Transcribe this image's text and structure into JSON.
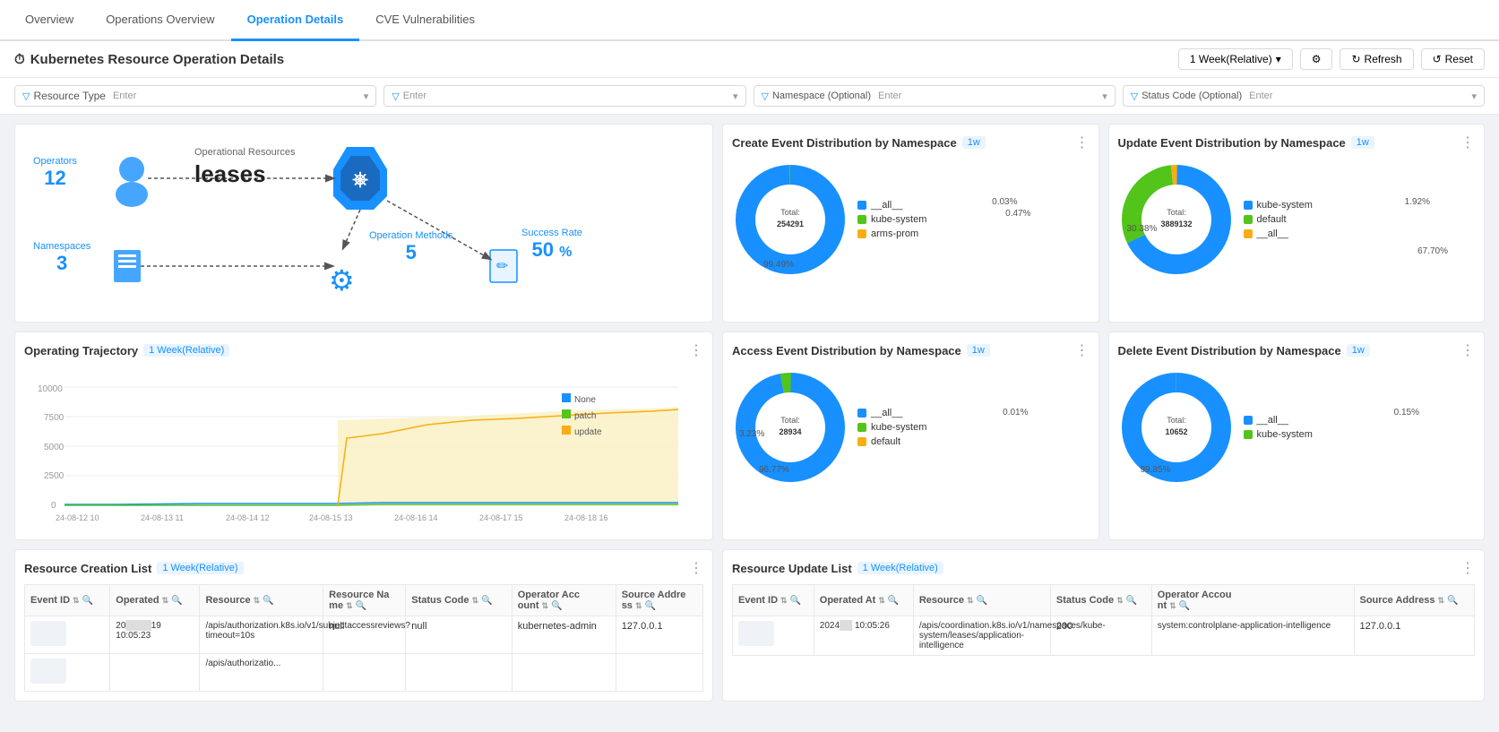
{
  "tabs": [
    {
      "label": "Overview",
      "active": false
    },
    {
      "label": "Operations Overview",
      "active": false
    },
    {
      "label": "Operation Details",
      "active": true
    },
    {
      "label": "CVE Vulnerabilities",
      "active": false
    }
  ],
  "header": {
    "title": "Kubernetes Resource Operation Details",
    "title_icon": "⏱",
    "time_range": "1 Week(Relative)",
    "refresh_label": "Refresh",
    "reset_label": "Reset"
  },
  "filters": [
    {
      "label": "Resource Type",
      "placeholder": "Enter"
    },
    {
      "placeholder": "Enter"
    },
    {
      "label": "Namespace (Optional)",
      "placeholder": "Enter"
    },
    {
      "label": "Status Code (Optional)",
      "placeholder": "Enter"
    }
  ],
  "diagram": {
    "operators_label": "Operators",
    "operators_count": "12",
    "namespaces_label": "Namespaces",
    "namespaces_count": "3",
    "resource_type_label": "Operational Resources",
    "resource_name": "leases",
    "op_methods_label": "Operation Methods",
    "op_methods_count": "5",
    "success_rate_label": "Success Rate",
    "success_rate_value": "50",
    "success_rate_unit": "%"
  },
  "charts": {
    "create": {
      "title": "Create Event Distribution by Namespace",
      "badge": "1w",
      "total": "Total:254291",
      "slices": [
        {
          "label": "__all__",
          "value": 99.49,
          "color": "#1890ff"
        },
        {
          "label": "kube-system",
          "value": 0.47,
          "color": "#52c41a"
        },
        {
          "label": "arms-prom",
          "value": 0.03,
          "color": "#faad14"
        }
      ],
      "annotations": [
        "99.49%",
        "0.47%",
        "0.03%"
      ]
    },
    "update": {
      "title": "Update Event Distribution by Namespace",
      "badge": "1w",
      "total": "Total:3889132",
      "slices": [
        {
          "label": "kube-system",
          "value": 67.7,
          "color": "#1890ff"
        },
        {
          "label": "default",
          "value": 30.38,
          "color": "#52c41a"
        },
        {
          "label": "__all__",
          "value": 1.92,
          "color": "#faad14"
        }
      ],
      "annotations": [
        "67.70%",
        "30.38%",
        "1.92%"
      ]
    },
    "access": {
      "title": "Access Event Distribution by Namespace",
      "badge": "1w",
      "total": "Total:28934",
      "slices": [
        {
          "label": "__all__",
          "value": 96.77,
          "color": "#1890ff"
        },
        {
          "label": "kube-system",
          "value": 3.23,
          "color": "#52c41a"
        },
        {
          "label": "default",
          "value": 0.01,
          "color": "#faad14"
        }
      ],
      "annotations": [
        "96.77%",
        "3.23%",
        "0.01%"
      ]
    },
    "delete": {
      "title": "Delete Event Distribution by Namespace",
      "badge": "1w",
      "total": "Total:10652",
      "slices": [
        {
          "label": "__all__",
          "value": 99.85,
          "color": "#1890ff"
        },
        {
          "label": "kube-system",
          "value": 0.15,
          "color": "#52c41a"
        }
      ],
      "annotations": [
        "99.85%",
        "0.15%"
      ]
    }
  },
  "trajectory": {
    "title": "Operating Trajectory",
    "badge": "1 Week(Relative)",
    "legend": [
      {
        "label": "None",
        "color": "#1890ff"
      },
      {
        "label": "patch",
        "color": "#52c41a"
      },
      {
        "label": "update",
        "color": "#faad14"
      }
    ],
    "x_labels": [
      "24-08-12 10",
      "24-08-13 11",
      "24-08-14 12",
      "24-08-15 13",
      "24-08-16 14",
      "24-08-17 15",
      "24-08-18 16"
    ],
    "y_labels": [
      "0",
      "2500",
      "5000",
      "7500",
      "10000"
    ]
  },
  "resource_creation_list": {
    "title": "Resource Creation List",
    "badge": "1 Week(Relative)",
    "columns": [
      "Event ID",
      "Operated At",
      "Resource",
      "Resource Name",
      "Status Code",
      "Operator Account",
      "Source Address"
    ],
    "rows": [
      {
        "event_id": "...",
        "operated_at": "20.. ..19 10:05:23",
        "resource": "/apis/authorization.k8s.io/v1/subjectaccessreviews?timeout=10s",
        "resource_name": "null",
        "status_code": "null",
        "operator_account": "kubernetes-admin",
        "source_address": "127.0.0.1"
      },
      {
        "event_id": "...",
        "operated_at": "...",
        "resource": "/apis/authorizatio...",
        "resource_name": "",
        "status_code": "",
        "operator_account": "",
        "source_address": ""
      }
    ]
  },
  "resource_update_list": {
    "title": "Resource Update List",
    "badge": "1 Week(Relative)",
    "columns": [
      "Event ID",
      "Operated At",
      "Resource",
      "Status Code",
      "Operator Account",
      "Source Address"
    ],
    "rows": [
      {
        "event_id": "...",
        "operated_at": "2024... 10:05:26",
        "resource": "/apis/coordination.k8s.io/v1/namespaces/kube-system/leases/application-intelligence",
        "status_code": "200",
        "operator_account": "system:controlplane-application-intelligence",
        "source_address": "127.0.0.1"
      }
    ]
  }
}
